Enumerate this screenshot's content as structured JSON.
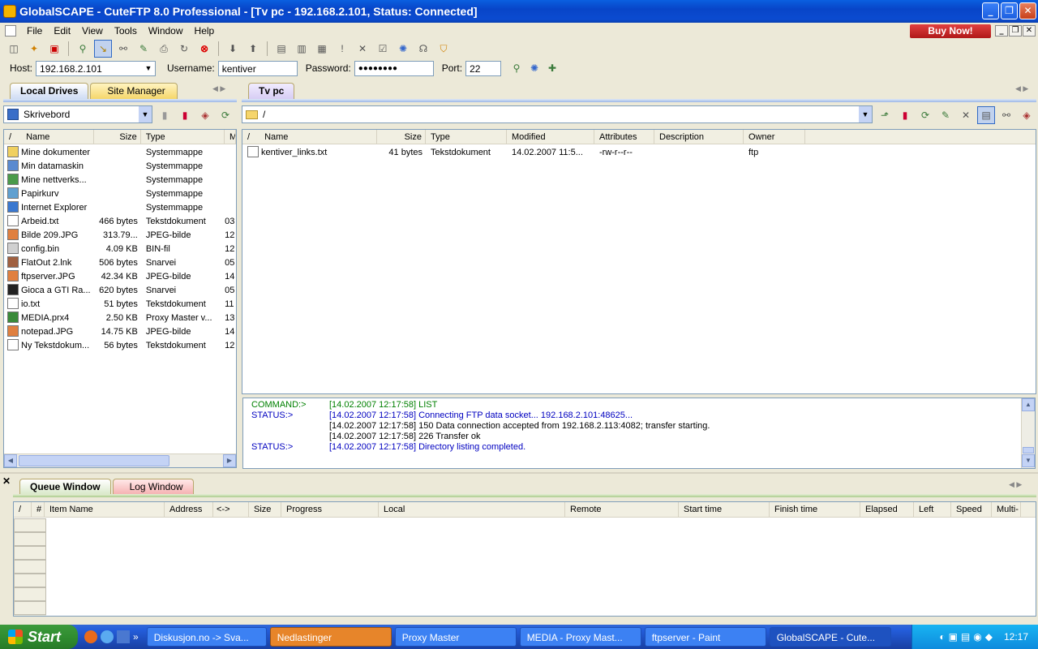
{
  "window": {
    "title": "GlobalSCAPE - CuteFTP 8.0 Professional - [Tv pc - 192.168.2.101, Status: Connected]"
  },
  "menu": [
    "File",
    "Edit",
    "View",
    "Tools",
    "Window",
    "Help"
  ],
  "buy_now": "Buy Now!",
  "conn": {
    "host_label": "Host:",
    "host": "192.168.2.101",
    "user_label": "Username:",
    "user": "kentiver",
    "pass_label": "Password:",
    "pass": "●●●●●●●●",
    "port_label": "Port:",
    "port": "22"
  },
  "left": {
    "tabs": [
      "Local Drives",
      "Site Manager"
    ],
    "path": "Skrivebord",
    "columns": [
      "Name",
      "Size",
      "Type",
      "M"
    ],
    "files": [
      {
        "name": "Mine dokumenter",
        "size": "",
        "type": "Systemmappe",
        "m": ""
      },
      {
        "name": "Min datamaskin",
        "size": "",
        "type": "Systemmappe",
        "m": ""
      },
      {
        "name": "Mine nettverks...",
        "size": "",
        "type": "Systemmappe",
        "m": ""
      },
      {
        "name": "Papirkurv",
        "size": "",
        "type": "Systemmappe",
        "m": ""
      },
      {
        "name": "Internet Explorer",
        "size": "",
        "type": "Systemmappe",
        "m": ""
      },
      {
        "name": "Arbeid.txt",
        "size": "466 bytes",
        "type": "Tekstdokument",
        "m": "03"
      },
      {
        "name": "Bilde 209.JPG",
        "size": "313.79...",
        "type": "JPEG-bilde",
        "m": "12"
      },
      {
        "name": "config.bin",
        "size": "4.09 KB",
        "type": "BIN-fil",
        "m": "12"
      },
      {
        "name": "FlatOut 2.lnk",
        "size": "506 bytes",
        "type": "Snarvei",
        "m": "05"
      },
      {
        "name": "ftpserver.JPG",
        "size": "42.34 KB",
        "type": "JPEG-bilde",
        "m": "14"
      },
      {
        "name": "Gioca a GTI Ra...",
        "size": "620 bytes",
        "type": "Snarvei",
        "m": "05"
      },
      {
        "name": "io.txt",
        "size": "51 bytes",
        "type": "Tekstdokument",
        "m": "11"
      },
      {
        "name": "MEDIA.prx4",
        "size": "2.50 KB",
        "type": "Proxy Master v...",
        "m": "13"
      },
      {
        "name": "notepad.JPG",
        "size": "14.75 KB",
        "type": "JPEG-bilde",
        "m": "14"
      },
      {
        "name": "Ny Tekstdokum...",
        "size": "56 bytes",
        "type": "Tekstdokument",
        "m": "12"
      }
    ]
  },
  "right": {
    "tab": "Tv pc",
    "path": "/",
    "columns": [
      "Name",
      "Size",
      "Type",
      "Modified",
      "Attributes",
      "Description",
      "Owner"
    ],
    "files": [
      {
        "name": "kentiver_links.txt",
        "size": "41 bytes",
        "type": "Tekstdokument",
        "modified": "14.02.2007 11:5...",
        "attributes": "-rw-r--r--",
        "description": "",
        "owner": "ftp"
      }
    ]
  },
  "log": [
    {
      "label": "COMMAND:>",
      "text": "[14.02.2007 12:17:58] LIST",
      "color": "#008000"
    },
    {
      "label": "STATUS:>",
      "text": "[14.02.2007 12:17:58] Connecting FTP data socket... 192.168.2.101:48625...",
      "color": "#0000c0"
    },
    {
      "label": "",
      "text": "[14.02.2007 12:17:58] 150 Data connection accepted from 192.168.2.113:4082; transfer starting.",
      "color": "#000000"
    },
    {
      "label": "",
      "text": "[14.02.2007 12:17:58] 226 Transfer ok",
      "color": "#000000"
    },
    {
      "label": "STATUS:>",
      "text": "[14.02.2007 12:17:58] Directory listing completed.",
      "color": "#0000c0"
    }
  ],
  "queue": {
    "tabs": [
      "Queue Window",
      "Log Window"
    ],
    "columns": [
      "/",
      "#",
      "Item Name",
      "Address",
      "<->",
      "Size",
      "Progress",
      "Local",
      "Remote",
      "Start time",
      "Finish time",
      "Elapsed",
      "Left",
      "Speed",
      "Multi-"
    ]
  },
  "taskbar": {
    "start": "Start",
    "items": [
      "Diskusjon.no -> Sva...",
      "Nedlastinger",
      "Proxy Master",
      "MEDIA - Proxy Mast...",
      "ftpserver - Paint",
      "GlobalSCAPE - Cute..."
    ],
    "clock": "12:17"
  }
}
